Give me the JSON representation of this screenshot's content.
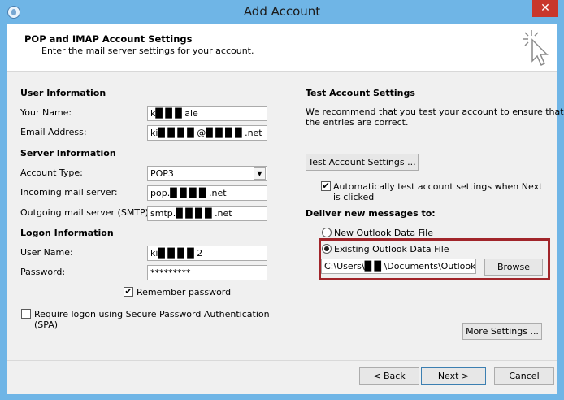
{
  "window": {
    "title": "Add Account",
    "close_glyph": "✕"
  },
  "header": {
    "title": "POP and IMAP Account Settings",
    "subtitle": "Enter the mail server settings for your account.",
    "icon": "cursor-sparkle-icon"
  },
  "user_info": {
    "section": "User Information",
    "name_label": "Your Name:",
    "name_value": "k█ █ █ ale",
    "email_label": "Email Address:",
    "email_value": "ki█ █ █ █ @█ █ █ █ .net"
  },
  "server_info": {
    "section": "Server Information",
    "account_type_label": "Account Type:",
    "account_type_value": "POP3",
    "incoming_label": "Incoming mail server:",
    "incoming_value": "pop.█ █ █ █ .net",
    "outgoing_label": "Outgoing mail server (SMTP):",
    "outgoing_value": "smtp.█ █ █ █ .net"
  },
  "logon_info": {
    "section": "Logon Information",
    "username_label": "User Name:",
    "username_value": "ki█ █ █ █ 2",
    "password_label": "Password:",
    "password_value": "*********",
    "remember_label": "Remember password",
    "remember_checked": true,
    "spa_label_1": "Require logon using Secure Password Authentication",
    "spa_label_2": "(SPA)",
    "spa_checked": false
  },
  "test_settings": {
    "section": "Test Account Settings",
    "desc_1": "We recommend that you test your account to ensure that",
    "desc_2": "the entries are correct.",
    "test_button": "Test Account Settings ...",
    "auto_test_1": "Automatically test account settings when Next",
    "auto_test_2": "is clicked",
    "auto_test_checked": true
  },
  "deliver": {
    "section": "Deliver new messages to:",
    "new_file_label": "New Outlook Data File",
    "existing_file_label": "Existing Outlook Data File",
    "selected": "existing",
    "path_value": "C:\\Users\\█ █ \\Documents\\Outlook Fil",
    "browse_button": "Browse"
  },
  "more_settings_button": "More Settings ...",
  "footer": {
    "back_button": "< Back",
    "next_button": "Next >",
    "cancel_button": "Cancel"
  },
  "colors": {
    "titlebar": "#6fb5e6",
    "close": "#c9372c",
    "highlight": "#a1252a"
  }
}
